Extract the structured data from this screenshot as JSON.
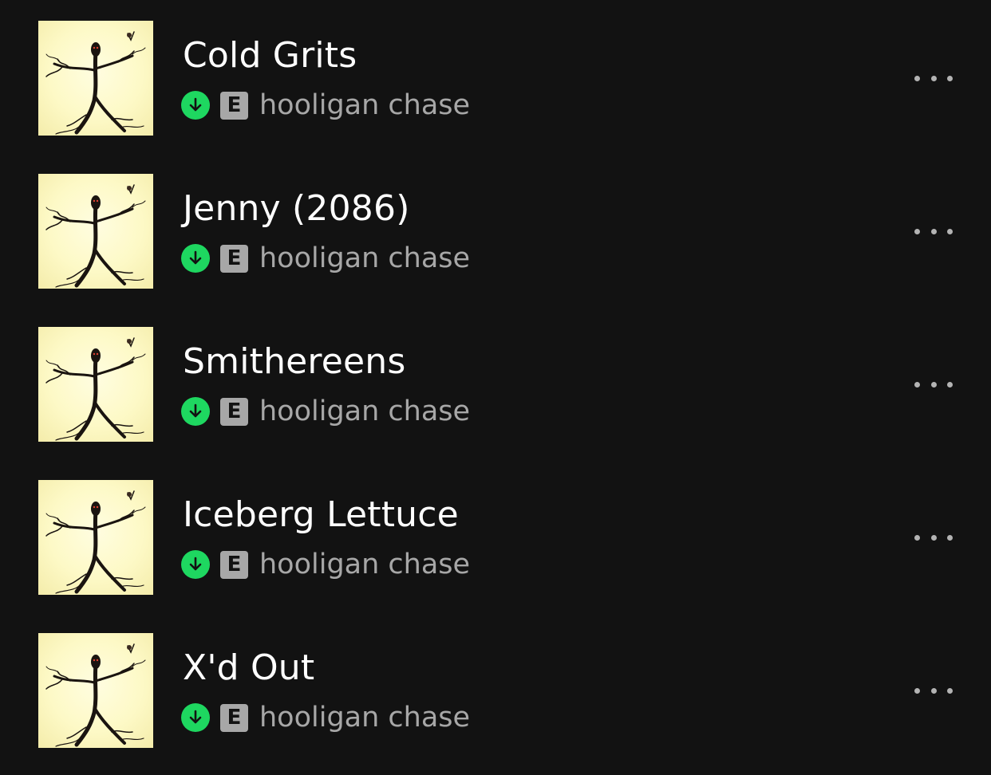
{
  "theme": {
    "background": "#121212",
    "title_color": "#ffffff",
    "secondary_color": "#a7a7a7",
    "download_color": "#1ed760"
  },
  "tracks": [
    {
      "title": "Cold Grits",
      "artist": "hooligan chase",
      "explicit_label": "E",
      "downloaded": true,
      "download_icon": "download-arrow-icon",
      "more_icon": "more-horizontal-icon"
    },
    {
      "title": "Jenny (2086)",
      "artist": "hooligan chase",
      "explicit_label": "E",
      "downloaded": true,
      "download_icon": "download-arrow-icon",
      "more_icon": "more-horizontal-icon"
    },
    {
      "title": "Smithereens",
      "artist": "hooligan chase",
      "explicit_label": "E",
      "downloaded": true,
      "download_icon": "download-arrow-icon",
      "more_icon": "more-horizontal-icon"
    },
    {
      "title": "Iceberg Lettuce",
      "artist": "hooligan chase",
      "explicit_label": "E",
      "downloaded": true,
      "download_icon": "download-arrow-icon",
      "more_icon": "more-horizontal-icon"
    },
    {
      "title": "X'd Out",
      "artist": "hooligan chase",
      "explicit_label": "E",
      "downloaded": true,
      "download_icon": "download-arrow-icon",
      "more_icon": "more-horizontal-icon"
    }
  ]
}
